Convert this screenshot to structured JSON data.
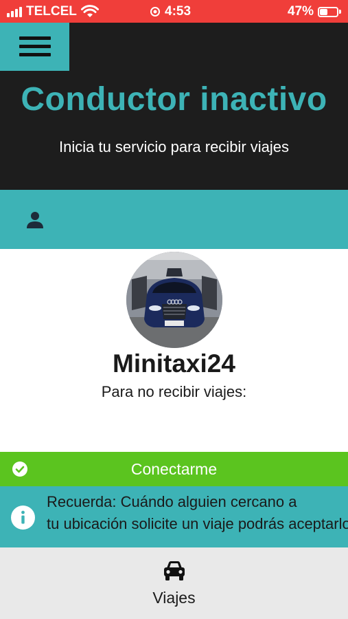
{
  "status_bar": {
    "carrier": "TELCEL",
    "time": "4:53",
    "battery": "47%",
    "battery_level": 0.47,
    "icons": [
      "signal-icon",
      "wifi-icon",
      "alarm-icon",
      "battery-icon"
    ]
  },
  "header": {
    "title": "Conductor inactivo",
    "subtitle": "Inicia tu servicio para recibir viajes",
    "menu_icon": "hamburger-icon"
  },
  "profile_bar": {
    "icon": "user-icon"
  },
  "profile": {
    "name": "Minitaxi24",
    "hint": "Para no recibir viajes:",
    "avatar": "car-photo"
  },
  "connect": {
    "label": "Conectarme",
    "icon": "check-circle-icon"
  },
  "info": {
    "icon": "info-icon",
    "text": "Recuerda: Cuándo alguien cercano a\ntu ubicación solicite un viaje podrás aceptarlo"
  },
  "bottom_nav": {
    "label": "Viajes",
    "icon": "car-icon"
  },
  "colors": {
    "status_bar": "#f03e3a",
    "accent": "#3db3b6",
    "header_bg": "#1d1d1d",
    "connect_green": "#5bc41f",
    "nav_bg": "#e9e9e9"
  }
}
